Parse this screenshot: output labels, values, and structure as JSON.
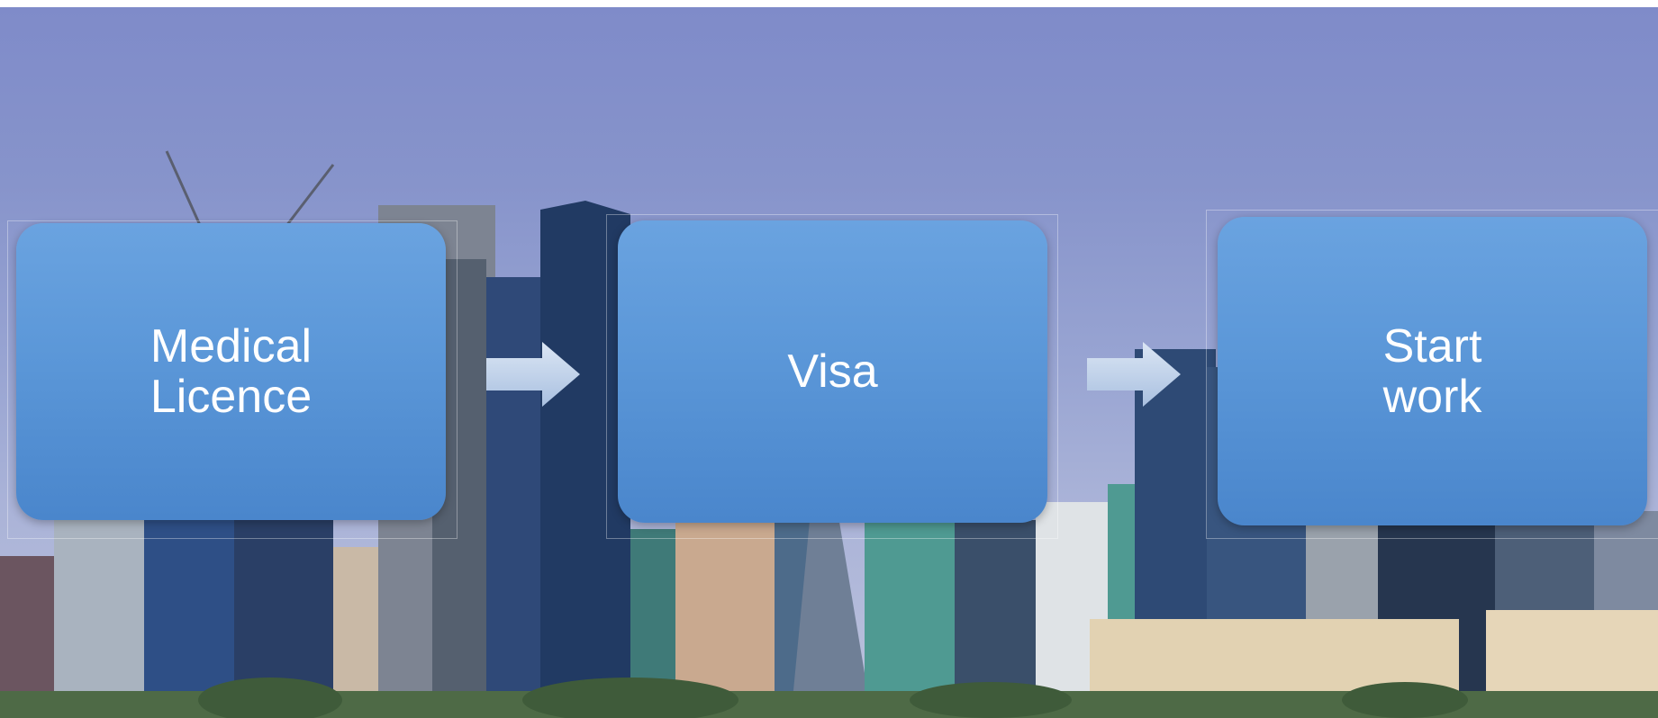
{
  "steps": [
    {
      "line1": "Medical",
      "line2": "Licence"
    },
    {
      "line1": "Visa"
    },
    {
      "line1": "Start",
      "line2": "work"
    }
  ],
  "colors": {
    "box": "#5b97d8",
    "box_text": "#ffffff",
    "arrow": "#c9d9ee",
    "sky": "#8794cb"
  },
  "icons": [
    "right-arrow-icon",
    "right-arrow-icon"
  ]
}
